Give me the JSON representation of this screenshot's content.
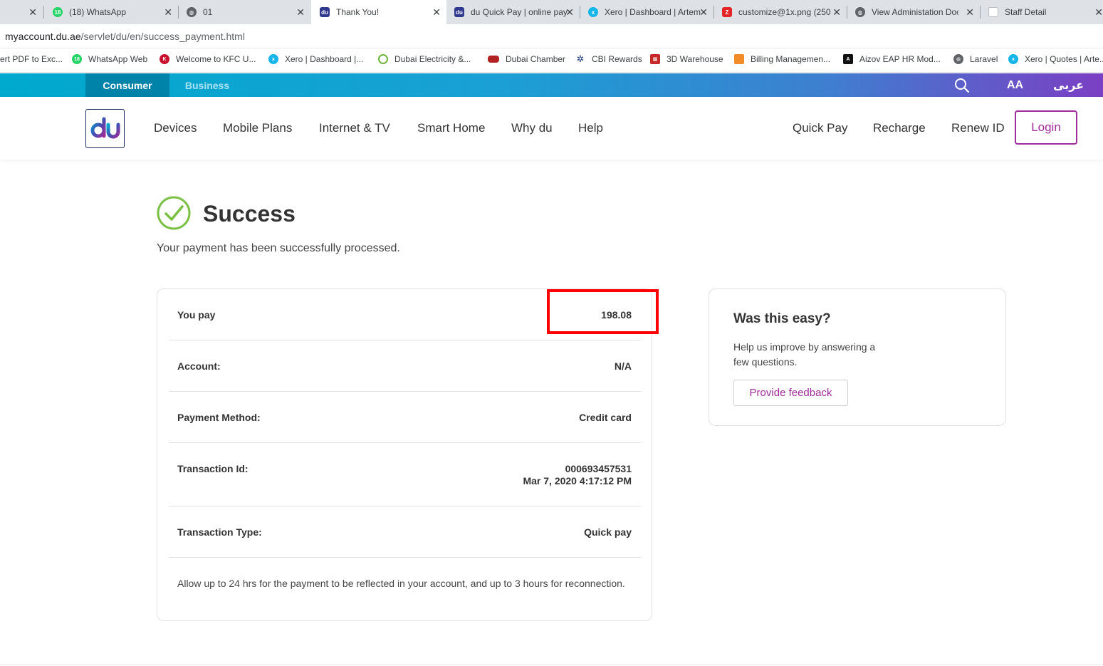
{
  "browser": {
    "tabs": [
      {
        "title": "",
        "favicon": "close-only",
        "active": false
      },
      {
        "title": "(18) WhatsApp",
        "favicon": "whatsapp-icon",
        "active": false
      },
      {
        "title": "01",
        "favicon": "globe-icon",
        "active": false
      },
      {
        "title": "Thank You!",
        "favicon": "du-icon",
        "active": true
      },
      {
        "title": "du Quick Pay | online pay",
        "favicon": "du-icon",
        "active": false
      },
      {
        "title": "Xero | Dashboard | Artemis",
        "favicon": "xero-icon",
        "active": false
      },
      {
        "title": "customize@1x.png (250",
        "favicon": "zoho-icon",
        "active": false
      },
      {
        "title": "View Administation Doc",
        "favicon": "globe-icon",
        "active": false
      },
      {
        "title": "Staff Detail",
        "favicon": "page-icon",
        "active": false
      }
    ],
    "url_host": "myaccount.du.ae",
    "url_path": "/servlet/du/en/success_payment.html",
    "bookmarks": [
      "ert PDF to Exc...",
      "WhatsApp Web",
      "Welcome to KFC U...",
      "Xero | Dashboard |...",
      "Dubai Electricity &...",
      "Dubai Chamber",
      "CBI Rewards",
      "3D Warehouse",
      "Billing Managemen...",
      "Aizov EAP HR Mod...",
      "Laravel",
      "Xero | Quotes | Arte..."
    ]
  },
  "site": {
    "segments": {
      "consumer": "Consumer",
      "business": "Business"
    },
    "text_size_label": "AA",
    "language_label": "عربى",
    "logo_text": "du",
    "nav": [
      "Devices",
      "Mobile Plans",
      "Internet & TV",
      "Smart Home",
      "Why du",
      "Help"
    ],
    "nav_right": [
      "Quick Pay",
      "Recharge",
      "Renew ID"
    ],
    "login_label": "Login"
  },
  "success": {
    "title": "Success",
    "subtitle": "Your payment has been successfully processed."
  },
  "receipt": {
    "you_pay_label": "You pay",
    "you_pay_value": "198.08",
    "account_label": "Account:",
    "account_value": "N/A",
    "method_label": "Payment Method:",
    "method_value": "Credit card",
    "txn_id_label": "Transaction Id:",
    "txn_id_value": "000693457531",
    "txn_date_value": "Mar 7, 2020 4:17:12 PM",
    "txn_type_label": "Transaction Type:",
    "txn_type_value": "Quick pay",
    "note": "Allow up to 24 hrs for the payment to be reflected in your account, and up to 3 hours for reconnection."
  },
  "feedback": {
    "title": "Was this easy?",
    "text": "Help us improve by answering a few questions.",
    "button": "Provide feedback"
  },
  "colors": {
    "brand_purple": "#a02c9a",
    "success_green": "#7ac143",
    "highlight_red": "#ff0000",
    "consumer_tab": "#0083a8"
  }
}
